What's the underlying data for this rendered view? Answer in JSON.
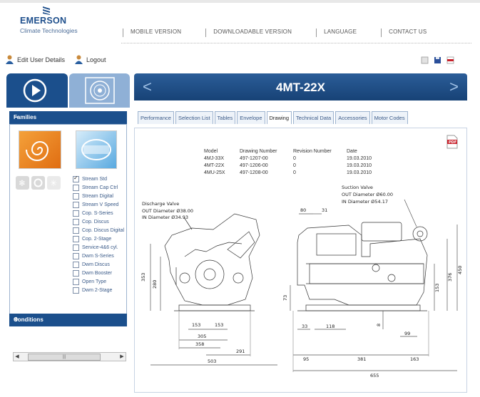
{
  "brand": {
    "name": "EMERSON",
    "subtitle": "Climate Technologies"
  },
  "topnav": [
    "MOBILE VERSION",
    "DOWNLOADABLE VERSION",
    "LANGUAGE",
    "CONTACT US"
  ],
  "user": {
    "edit_label": "Edit User Details",
    "logout_label": "Logout"
  },
  "families": {
    "header": "Families",
    "collapse_symbol": "−",
    "items": [
      {
        "label": "Stream Std",
        "checked": true
      },
      {
        "label": "Stream Cap Ctrl",
        "checked": false
      },
      {
        "label": "Stream Digital",
        "checked": false
      },
      {
        "label": "Stream V Speed",
        "checked": false
      },
      {
        "label": "Cop. S-Series",
        "checked": false
      },
      {
        "label": "Cop. Discus",
        "checked": false
      },
      {
        "label": "Cop. Discus Digital",
        "checked": false
      },
      {
        "label": "Cop. 2-Stage",
        "checked": false
      },
      {
        "label": "Service-4&6 cyl.",
        "checked": false
      },
      {
        "label": "Dwm S-Series",
        "checked": false
      },
      {
        "label": "Dwm Discus",
        "checked": false
      },
      {
        "label": "Dwm Booster",
        "checked": false
      },
      {
        "label": "Open Type",
        "checked": false
      },
      {
        "label": "Dwm 2-Stage",
        "checked": false
      }
    ]
  },
  "conditions": {
    "header": "Conditions",
    "expand_symbol": "+"
  },
  "product": {
    "title": "4MT-22X",
    "prev_symbol": "<",
    "next_symbol": ">"
  },
  "tabs": [
    "Performance",
    "Selection List",
    "Tables",
    "Envelope",
    "Drawing",
    "Technical Data",
    "Accessories",
    "Motor Codes"
  ],
  "active_tab": "Drawing",
  "model_table": {
    "headers": [
      "Model",
      "Drawing Number",
      "Revision Number",
      "Date"
    ],
    "rows": [
      [
        "4MJ-33X",
        "497-1207-00",
        "0",
        "19.03.2010"
      ],
      [
        "4MT-22X",
        "497-1206-00",
        "0",
        "19.03.2010"
      ],
      [
        "4MU-25X",
        "497-1208-00",
        "0",
        "19.03.2010"
      ]
    ]
  },
  "drawing": {
    "discharge": [
      "Discharge Valve",
      "OUT Diameter Ø38.00",
      "IN Diameter Ø34.93"
    ],
    "suction": [
      "Suction Valve",
      "OUT Diameter Ø60.00",
      "IN Diameter Ø54.17"
    ],
    "dims_left": {
      "h353": "353",
      "h280": "280",
      "w153a": "153",
      "w153b": "153",
      "w305": "305",
      "w358": "358",
      "w291": "291",
      "w503": "503"
    },
    "dims_right": {
      "d80": "80",
      "d31": "31",
      "d73": "73",
      "d33": "33",
      "d118": "118",
      "d8": "8",
      "d99": "99",
      "d153": "153",
      "d376": "376",
      "d450": "450",
      "d95": "95",
      "d381": "381",
      "d163": "163",
      "d655": "655"
    }
  },
  "icons": {
    "user": "user-icon",
    "logout": "logout-icon",
    "print": "print-icon",
    "save": "save-icon",
    "pdf": "pdf-icon"
  },
  "colors": {
    "brand_blue": "#1b4f8c",
    "accent_blue": "#8fb0d6",
    "orange": "#f4a13a"
  }
}
